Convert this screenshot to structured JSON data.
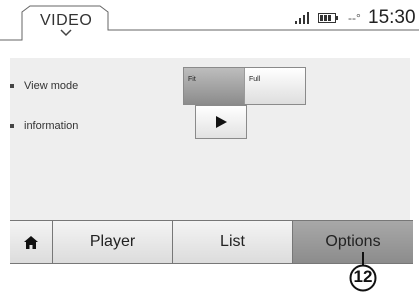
{
  "header": {
    "title": "VIDEO",
    "temperature": "--°",
    "time": "15:30",
    "icons": [
      "chevron-down-icon",
      "signal-icon",
      "battery-icon"
    ]
  },
  "settings": {
    "view_mode_label": "View mode",
    "view_mode_options": [
      "Fit",
      "Full"
    ],
    "view_mode_selected": "Fit",
    "information_label": "information"
  },
  "tabbar": {
    "tabs": [
      "Player",
      "List",
      "Options"
    ],
    "active_tab": "Options",
    "home_icon": "home-icon"
  },
  "callout": {
    "number": "12"
  },
  "colors": {
    "active_tab": "#9a9a9a",
    "selected_segment": "#a5a5a5"
  }
}
